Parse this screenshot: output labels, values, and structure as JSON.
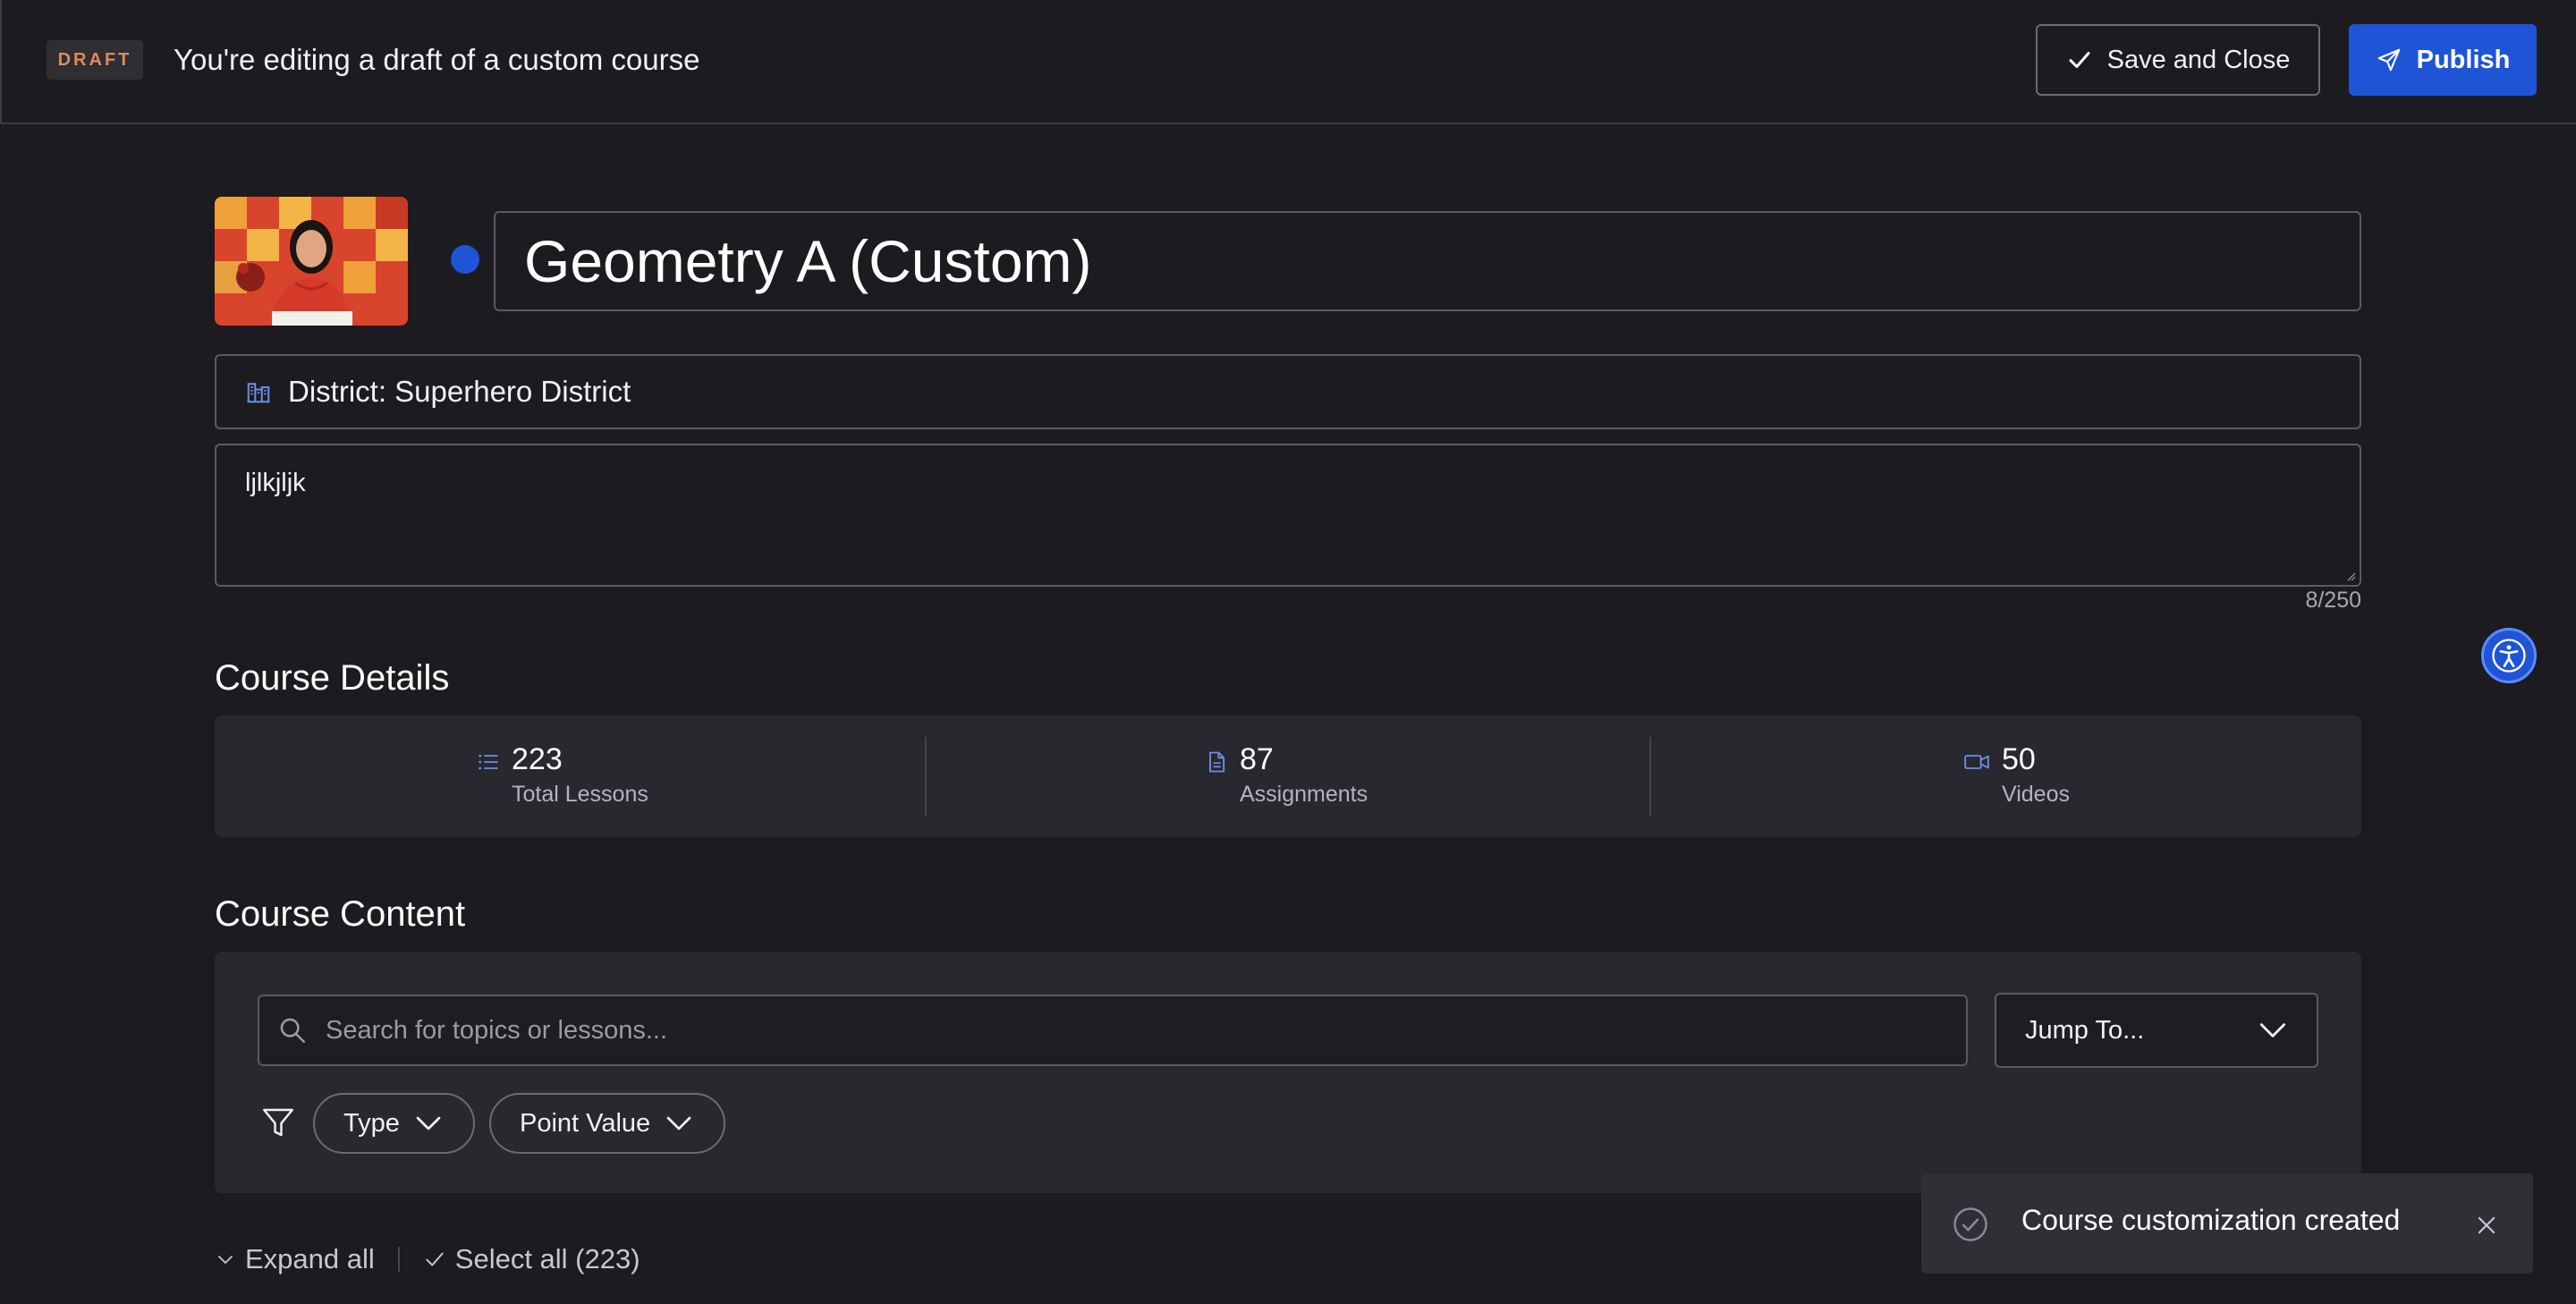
{
  "topbar": {
    "badge": "DRAFT",
    "title": "You're editing a draft of a custom course",
    "save_label": "Save and Close",
    "publish_label": "Publish"
  },
  "course": {
    "title": "Geometry A (Custom)",
    "district": "District: Superhero District",
    "description": "ljlkjljk",
    "char_count": "8/250"
  },
  "details": {
    "heading": "Course Details",
    "stats": [
      {
        "value": "223",
        "label": "Total Lessons",
        "icon": "list-icon"
      },
      {
        "value": "87",
        "label": "Assignments",
        "icon": "document-icon"
      },
      {
        "value": "50",
        "label": "Videos",
        "icon": "video-icon"
      }
    ]
  },
  "content": {
    "heading": "Course Content",
    "search_placeholder": "Search for topics or lessons...",
    "jump_label": "Jump To...",
    "filters": [
      "Type",
      "Point Value"
    ]
  },
  "bottom": {
    "expand_all": "Expand all",
    "select_all": "Select all (223)"
  },
  "toast": {
    "message": "Course customization created"
  },
  "colors": {
    "accent": "#1f54d6",
    "background": "#1c1c20",
    "card": "#28282e",
    "draft_badge_text": "#e08a5a"
  }
}
